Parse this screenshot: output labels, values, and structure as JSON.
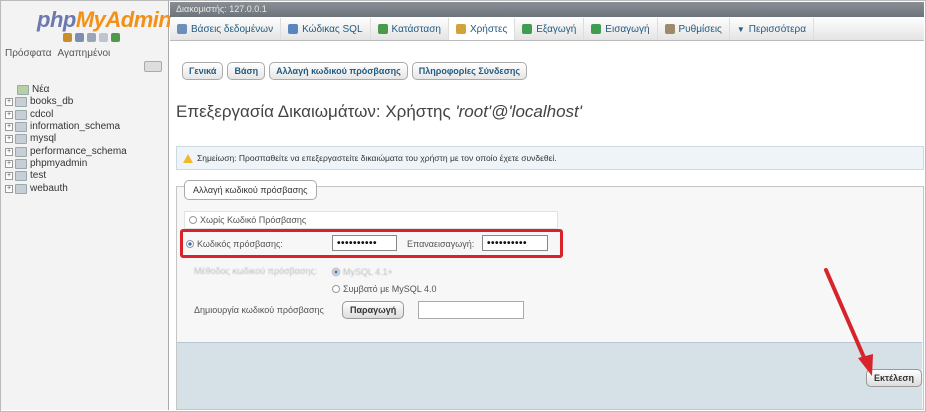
{
  "nav": {
    "logo_php": "php",
    "logo_myadmin": "MyAdmin",
    "tabs": [
      "Πρόσφατα",
      "Αγαπημένοι"
    ],
    "new_label": "Νέα",
    "databases": [
      "books_db",
      "cdcol",
      "information_schema",
      "mysql",
      "performance_schema",
      "phpmyadmin",
      "test",
      "webauth"
    ]
  },
  "topbar": {
    "server": "Διακομιστής: 127.0.0.1"
  },
  "menu": [
    {
      "label": "Βάσεις δεδομένων",
      "icon": "database-icon",
      "color": "#6b8fb8"
    },
    {
      "label": "Κώδικας SQL",
      "icon": "sql-icon",
      "color": "#5a86c0"
    },
    {
      "label": "Κατάσταση",
      "icon": "status-chart-icon",
      "color": "#4a9a4a"
    },
    {
      "label": "Χρήστες",
      "icon": "users-icon",
      "color": "#d4a23a"
    },
    {
      "label": "Εξαγωγή",
      "icon": "export-icon",
      "color": "#3f9d52"
    },
    {
      "label": "Εισαγωγή",
      "icon": "import-icon",
      "color": "#3f9d52"
    },
    {
      "label": "Ρυθμίσεις",
      "icon": "wrench-icon",
      "color": "#9b8a6b"
    },
    {
      "label": "Περισσότερα",
      "icon": "more-arrow-icon",
      "color": "#235a81"
    }
  ],
  "subtabs": [
    "Γενικά",
    "Βάση",
    "Αλλαγή κωδικού πρόσβασης",
    "Πληροφορίες Σύνδεσης"
  ],
  "title": {
    "prefix": "Επεξεργασία Δικαιωμάτων: Χρήστης ",
    "user": "'root'@'localhost'"
  },
  "notice": "Σημείωση: Προσπαθείτε να επεξεργαστείτε δικαιώματα του χρήστη με τον οποίο έχετε συνδεθεί.",
  "form": {
    "legend": "Αλλαγή κωδικού πρόσβασης",
    "no_password": "Χωρίς Κωδικό Πρόσβασης",
    "password_label": "Κωδικός πρόσβασης:",
    "password_value": "••••••••••",
    "retype_label": "Επαναεισαγωγή:",
    "retype_value": "••••••••••",
    "hashing_label": "Μέθοδος κωδικού πρόσβασης:",
    "hashing_option1": "MySQL 4.1+",
    "hashing_option2": "Συμβατό με MySQL 4.0",
    "generate_label": "Δημιουργία κωδικού πρόσβασης",
    "generate_button": "Παραγωγή",
    "submit": "Εκτέλεση"
  }
}
